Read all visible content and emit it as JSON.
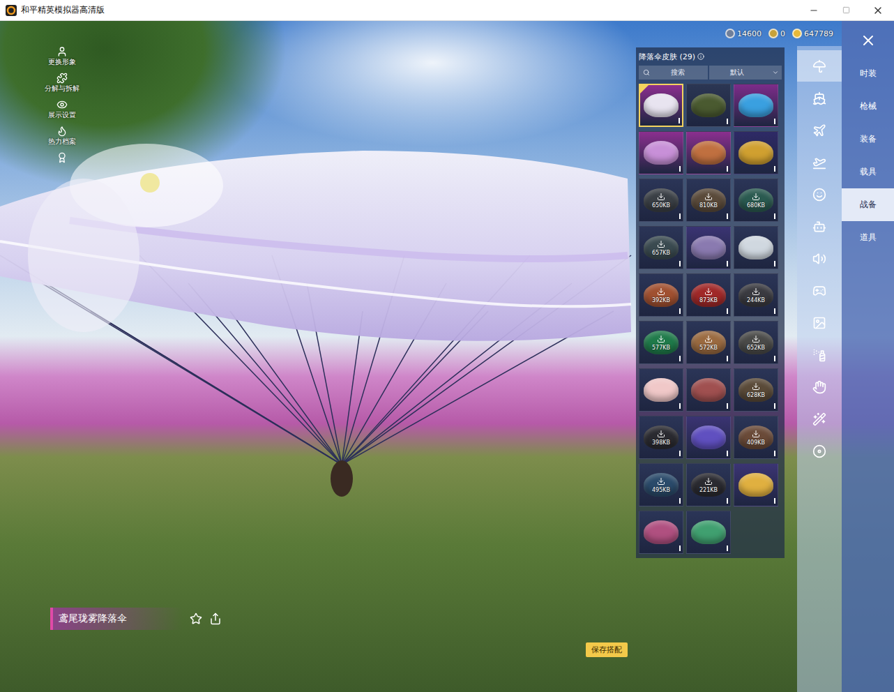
{
  "window": {
    "title": "和平精英模拟器高清版"
  },
  "left_menu": [
    {
      "label": "更换形象"
    },
    {
      "label": "分解与拆解"
    },
    {
      "label": "展示设置"
    },
    {
      "label": "热力档案"
    },
    {
      "label": ""
    }
  ],
  "currencies": [
    {
      "value": "14600",
      "color": "#6f7f9a"
    },
    {
      "value": "0",
      "color": "#c7a23a"
    },
    {
      "value": "647789",
      "color": "#e8b93a"
    }
  ],
  "panel": {
    "title": "降落伞皮肤 (29)",
    "search": {
      "placeholder": "搜索"
    },
    "sort": {
      "value": "默认"
    },
    "items": [
      {
        "kind": "owned",
        "selected": true,
        "color": "#8b2f8f",
        "canopy": "#e8e4f0"
      },
      {
        "kind": "owned",
        "selected": false,
        "color": "#2b3653",
        "canopy": "#4a5a30"
      },
      {
        "kind": "owned",
        "selected": false,
        "color": "#7d2c8a",
        "canopy": "#3aa0e0"
      },
      {
        "kind": "owned",
        "selected": false,
        "color": "#8b2f8f",
        "canopy": "#c890d8"
      },
      {
        "kind": "owned",
        "selected": false,
        "color": "#8b2f8f",
        "canopy": "#c07040"
      },
      {
        "kind": "owned",
        "selected": false,
        "color": "#2e2a66",
        "canopy": "#d0a030"
      },
      {
        "kind": "download",
        "selected": false,
        "size": "650KB",
        "color": "#2b3557",
        "canopy": "#3a3f45"
      },
      {
        "kind": "download",
        "selected": false,
        "size": "810KB",
        "color": "#2b3557",
        "canopy": "#5a4a3a"
      },
      {
        "kind": "download",
        "selected": false,
        "size": "680KB",
        "color": "#2b3557",
        "canopy": "#2a5a50"
      },
      {
        "kind": "download",
        "selected": false,
        "size": "657KB",
        "color": "#2b3557",
        "canopy": "#3a4a50"
      },
      {
        "kind": "owned",
        "selected": false,
        "color": "#3b3473",
        "canopy": "#8a7ab0"
      },
      {
        "kind": "owned",
        "selected": false,
        "color": "#2b3557",
        "canopy": "#d0d8e0"
      },
      {
        "kind": "download",
        "selected": false,
        "size": "392KB",
        "color": "#2b3557",
        "canopy": "#a05030"
      },
      {
        "kind": "download",
        "selected": false,
        "size": "873KB",
        "color": "#2b3557",
        "canopy": "#a02828"
      },
      {
        "kind": "download",
        "selected": false,
        "size": "244KB",
        "color": "#2b3557",
        "canopy": "#3a3a40"
      },
      {
        "kind": "download",
        "selected": false,
        "size": "577KB",
        "color": "#2b3557",
        "canopy": "#1f7a4a"
      },
      {
        "kind": "download",
        "selected": false,
        "size": "572KB",
        "color": "#2b3557",
        "canopy": "#9a6a40"
      },
      {
        "kind": "download",
        "selected": false,
        "size": "652KB",
        "color": "#2b3557",
        "canopy": "#4a4a48"
      },
      {
        "kind": "owned",
        "selected": false,
        "color": "#2b3557",
        "canopy": "#f0c8c8"
      },
      {
        "kind": "owned",
        "selected": false,
        "color": "#2b3557",
        "canopy": "#a05050"
      },
      {
        "kind": "download",
        "selected": false,
        "size": "628KB",
        "color": "#2b3557",
        "canopy": "#5a4a38"
      },
      {
        "kind": "download",
        "selected": false,
        "size": "398KB",
        "color": "#2b3557",
        "canopy": "#2a2a30"
      },
      {
        "kind": "owned",
        "selected": false,
        "color": "#3b3473",
        "canopy": "#6050c0"
      },
      {
        "kind": "download",
        "selected": false,
        "size": "409KB",
        "color": "#2b3557",
        "canopy": "#6a4a38"
      },
      {
        "kind": "download",
        "selected": false,
        "size": "495KB",
        "color": "#2b3557",
        "canopy": "#2a4a6a"
      },
      {
        "kind": "download",
        "selected": false,
        "size": "221KB",
        "color": "#2b3557",
        "canopy": "#2a2a30"
      },
      {
        "kind": "owned",
        "selected": false,
        "color": "#3b3473",
        "canopy": "#e0b040"
      },
      {
        "kind": "owned",
        "selected": false,
        "color": "#2b3557",
        "canopy": "#b05080"
      },
      {
        "kind": "owned",
        "selected": false,
        "color": "#2b3557",
        "canopy": "#40a070"
      }
    ]
  },
  "icon_tabs": [
    {
      "selected": true
    },
    {
      "selected": false
    },
    {
      "selected": false
    },
    {
      "selected": false
    },
    {
      "selected": false
    },
    {
      "selected": false
    },
    {
      "selected": false
    },
    {
      "selected": false
    },
    {
      "selected": false
    },
    {
      "selected": false
    },
    {
      "selected": false
    },
    {
      "selected": false
    },
    {
      "selected": false
    }
  ],
  "categories": [
    {
      "label": "时装",
      "selected": false
    },
    {
      "label": "枪械",
      "selected": false
    },
    {
      "label": "装备",
      "selected": false
    },
    {
      "label": "载具",
      "selected": false
    },
    {
      "label": "战备",
      "selected": true
    },
    {
      "label": "道具",
      "selected": false
    }
  ],
  "item_name": "鸢尾珑雾降落伞",
  "save_button": "保存搭配"
}
